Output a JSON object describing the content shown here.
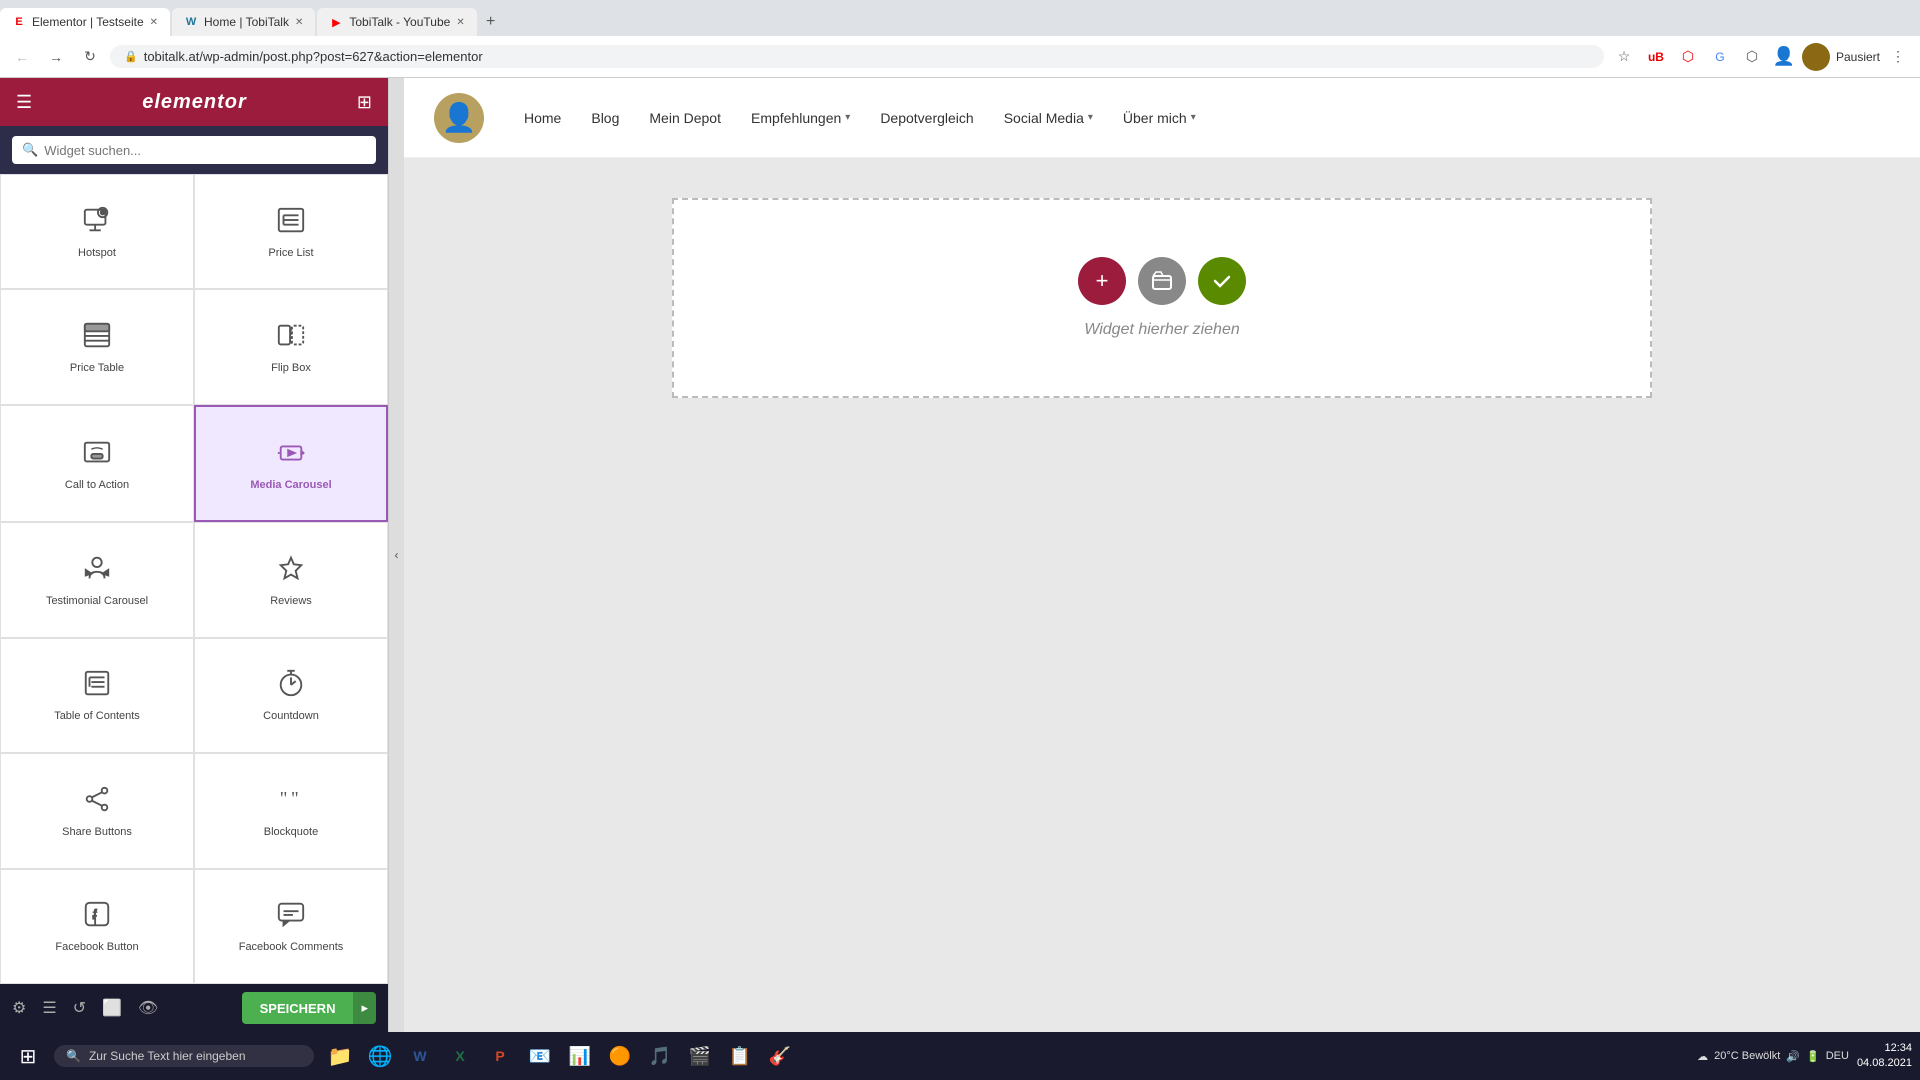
{
  "browser": {
    "tabs": [
      {
        "id": "tab1",
        "title": "Elementor | Testseite",
        "favicon": "E",
        "active": true
      },
      {
        "id": "tab2",
        "title": "Home | TobiTalk",
        "favicon": "W",
        "active": false
      },
      {
        "id": "tab3",
        "title": "TobiTalk - YouTube",
        "favicon": "▶",
        "active": false
      }
    ],
    "address": "tobitalk.at/wp-admin/post.php?post=627&action=elementor",
    "profile_label": "Pausiert"
  },
  "sidebar": {
    "title": "elementor",
    "search_placeholder": "Widget suchen...",
    "widgets": [
      {
        "id": "hotspot",
        "label": "Hotspot",
        "icon": "hotspot"
      },
      {
        "id": "price-list",
        "label": "Price List",
        "icon": "pricelist"
      },
      {
        "id": "price-table",
        "label": "Price Table",
        "icon": "pricetable"
      },
      {
        "id": "flip-box",
        "label": "Flip Box",
        "icon": "flipbox"
      },
      {
        "id": "call-to-action",
        "label": "Call to Action",
        "icon": "calltoaction"
      },
      {
        "id": "media-carousel",
        "label": "Media Carousel",
        "icon": "mediacarousel",
        "active": true
      },
      {
        "id": "testimonial-carousel",
        "label": "Testimonial Carousel",
        "icon": "testimonial"
      },
      {
        "id": "reviews",
        "label": "Reviews",
        "icon": "reviews"
      },
      {
        "id": "table-of-contents",
        "label": "Table of Contents",
        "icon": "toc"
      },
      {
        "id": "countdown",
        "label": "Countdown",
        "icon": "countdown"
      },
      {
        "id": "share-buttons",
        "label": "Share Buttons",
        "icon": "sharebtn"
      },
      {
        "id": "blockquote",
        "label": "Blockquote",
        "icon": "blockquote"
      },
      {
        "id": "facebook-button",
        "label": "Facebook Button",
        "icon": "fbbutton"
      },
      {
        "id": "facebook-comments",
        "label": "Facebook Comments",
        "icon": "fbcomments"
      }
    ],
    "save_label": "SPEICHERN",
    "bottom_icons": [
      "settings",
      "layers",
      "history",
      "responsive",
      "preview"
    ]
  },
  "canvas": {
    "hint": "Widget hierher ziehen",
    "actions": [
      {
        "label": "+",
        "type": "add"
      },
      {
        "label": "▣",
        "type": "folder"
      },
      {
        "label": "✓",
        "type": "check"
      }
    ]
  },
  "wp_nav": {
    "links": [
      "Home",
      "Blog",
      "Mein Depot",
      "Empfehlungen",
      "Depotvergleich",
      "Social Media",
      "Über mich"
    ]
  },
  "taskbar": {
    "search_placeholder": "Zur Suche Text hier eingeben",
    "clock_time": "12:34",
    "clock_date": "04.08.2021",
    "temp": "20°C Bewölkt",
    "lang": "DEU"
  }
}
